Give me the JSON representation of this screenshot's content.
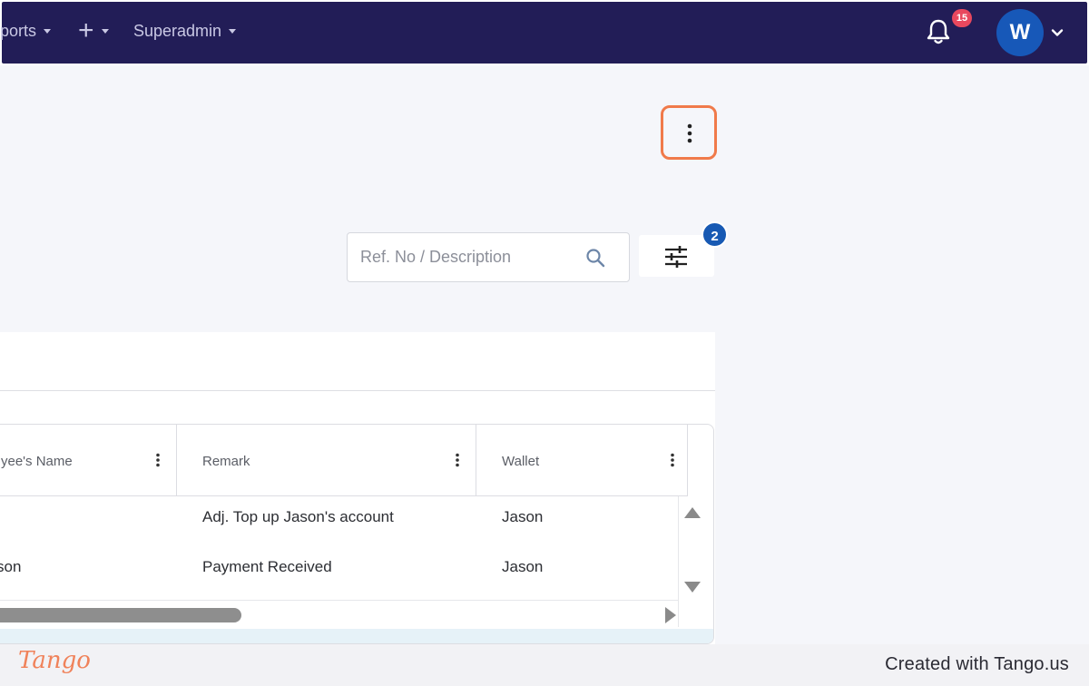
{
  "topbar": {
    "nav": [
      {
        "label": "ports"
      },
      {
        "label": "+"
      },
      {
        "label": "Superadmin"
      }
    ],
    "notifications_count": "15",
    "avatar_initial": "W"
  },
  "toolbar": {
    "search_placeholder": "Ref. No / Description",
    "filter_count": "2"
  },
  "grid": {
    "columns": [
      {
        "label": "yee's Name"
      },
      {
        "label": "Remark"
      },
      {
        "label": "Wallet"
      }
    ],
    "rows": [
      {
        "name": "",
        "remark": "Adj. Top up Jason's account",
        "wallet": "Jason"
      },
      {
        "name": "son",
        "remark": "Payment Received",
        "wallet": "Jason"
      }
    ]
  },
  "footer": {
    "logo": "Tango",
    "credit": "Created with Tango.us"
  },
  "colors": {
    "topbar": "#221d57",
    "highlight": "#f07a4a",
    "notification_badge": "#e8485e",
    "filter_badge": "#1759b3",
    "avatar": "#1758b8"
  },
  "icons": [
    "chevron-down-icon",
    "plus-icon",
    "bell-icon",
    "more-vertical-icon",
    "search-icon",
    "sliders-icon",
    "scroll-up-icon",
    "scroll-down-icon",
    "scroll-right-icon"
  ]
}
